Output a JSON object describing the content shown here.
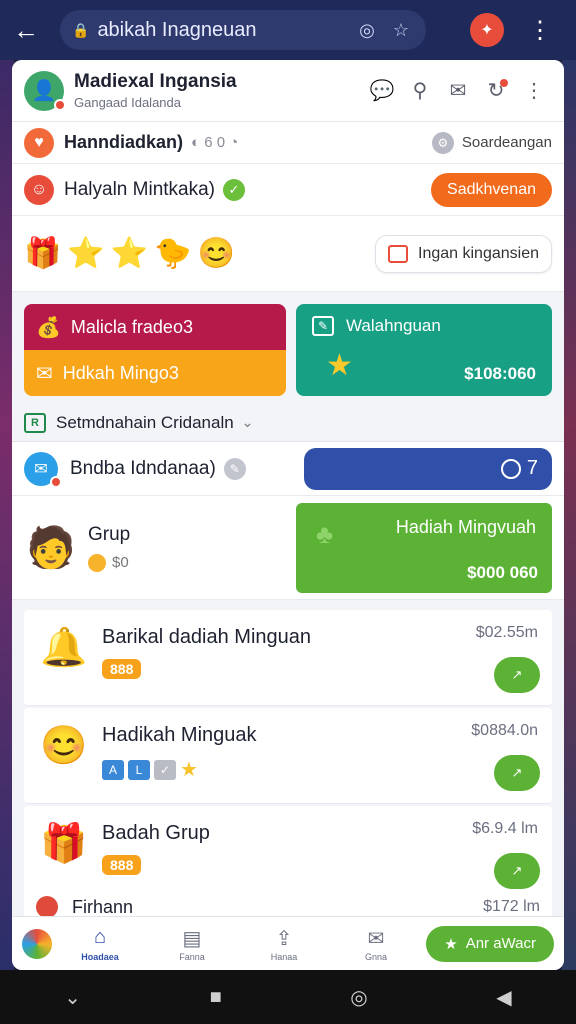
{
  "browser": {
    "url": "abikah Inagneuan",
    "lock_icon": "lock-icon",
    "colors": {
      "bar": "#1f2a5a"
    }
  },
  "header": {
    "title": "Madiexal Ingansia",
    "subtitle": "Gangaad Idalanda"
  },
  "row_a": {
    "label": "Hanndiadkan)",
    "mini": "◐ 6 0 ◔",
    "right_label": "Soardeangan"
  },
  "row_b": {
    "label": "Halyaln Mintkaka)",
    "button": "Sadkhvenan"
  },
  "row_c": {
    "emojis": [
      "🎁",
      "⭐",
      "⭐",
      "🐤",
      "😊"
    ],
    "button": "Ingan kingansien"
  },
  "cards": {
    "left_top": "Malicla fradeo3",
    "left_bottom": "Hdkah Mingo3",
    "right_title": "Walahnguan",
    "right_amount": "$108:060"
  },
  "dropdown": {
    "label": "Setmdnahain Cridanaln",
    "icon_text": "R"
  },
  "row_d": {
    "label": "Bndba Idndanaa)",
    "pill_text": "7"
  },
  "group": {
    "title": "Grup",
    "coin_text": "$0",
    "card_title": "Hadiah Mingvuah",
    "card_amount": "$000 060"
  },
  "list": [
    {
      "title": "Barikal dadiah Minguan",
      "tag": "888",
      "price": "$02.55m",
      "action": "↗"
    },
    {
      "title": "Hadikah Minguak",
      "tag": "",
      "price": "$0884.0n",
      "action": "↗"
    },
    {
      "title": "Badah Grup",
      "tag": "888",
      "price": "$6.9.4 lm",
      "action": "↗"
    }
  ],
  "peek": {
    "title": "Firhann",
    "price": "$172 lm"
  },
  "nav": {
    "items": [
      {
        "label": "Hoadaea"
      },
      {
        "label": "Fanna"
      },
      {
        "label": "Hanaa"
      },
      {
        "label": "Gnna"
      }
    ],
    "cta": "Anr aWacr"
  }
}
